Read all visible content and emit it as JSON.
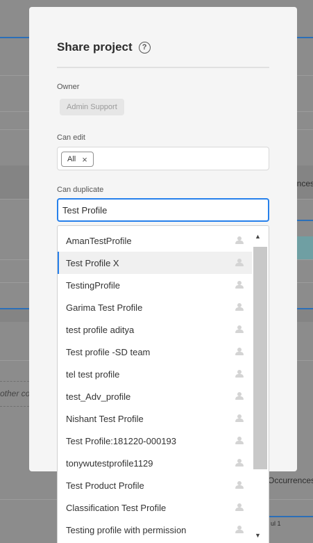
{
  "background": {
    "text_occurrences_right": "ences",
    "text_occurrences_lower": "Occurrences",
    "text_other": "other co",
    "text_bottom": "ul 1"
  },
  "modal": {
    "title": "Share project",
    "help_icon_glyph": "?",
    "owner": {
      "label": "Owner",
      "value": "Admin Support"
    },
    "can_edit": {
      "label": "Can edit",
      "tags": [
        {
          "label": "All",
          "remove_glyph": "×"
        }
      ]
    },
    "can_duplicate": {
      "label": "Can duplicate",
      "input_value": "Test Profile"
    }
  },
  "dropdown": {
    "items": [
      {
        "label": "AmanTestProfile"
      },
      {
        "label": "Test Profile X",
        "highlighted": true
      },
      {
        "label": "TestingProfile"
      },
      {
        "label": "Garima Test Profile"
      },
      {
        "label": "test profile aditya"
      },
      {
        "label": "Test profile -SD team"
      },
      {
        "label": "tel test profile"
      },
      {
        "label": "test_Adv_profile"
      },
      {
        "label": "Nishant Test Profile"
      },
      {
        "label": "Test Profile:181220-000193"
      },
      {
        "label": "tonywutestprofile1129"
      },
      {
        "label": "Test Product Profile"
      },
      {
        "label": "Classification Test Profile"
      },
      {
        "label": "Testing profile with permission"
      }
    ],
    "item_icon": "user-icon",
    "scroll_up_glyph": "▲",
    "scroll_down_glyph": "▼"
  },
  "colors": {
    "accent": "#2680eb",
    "modal_bg": "#f5f5f5",
    "overlay": "#8c8c8c"
  }
}
